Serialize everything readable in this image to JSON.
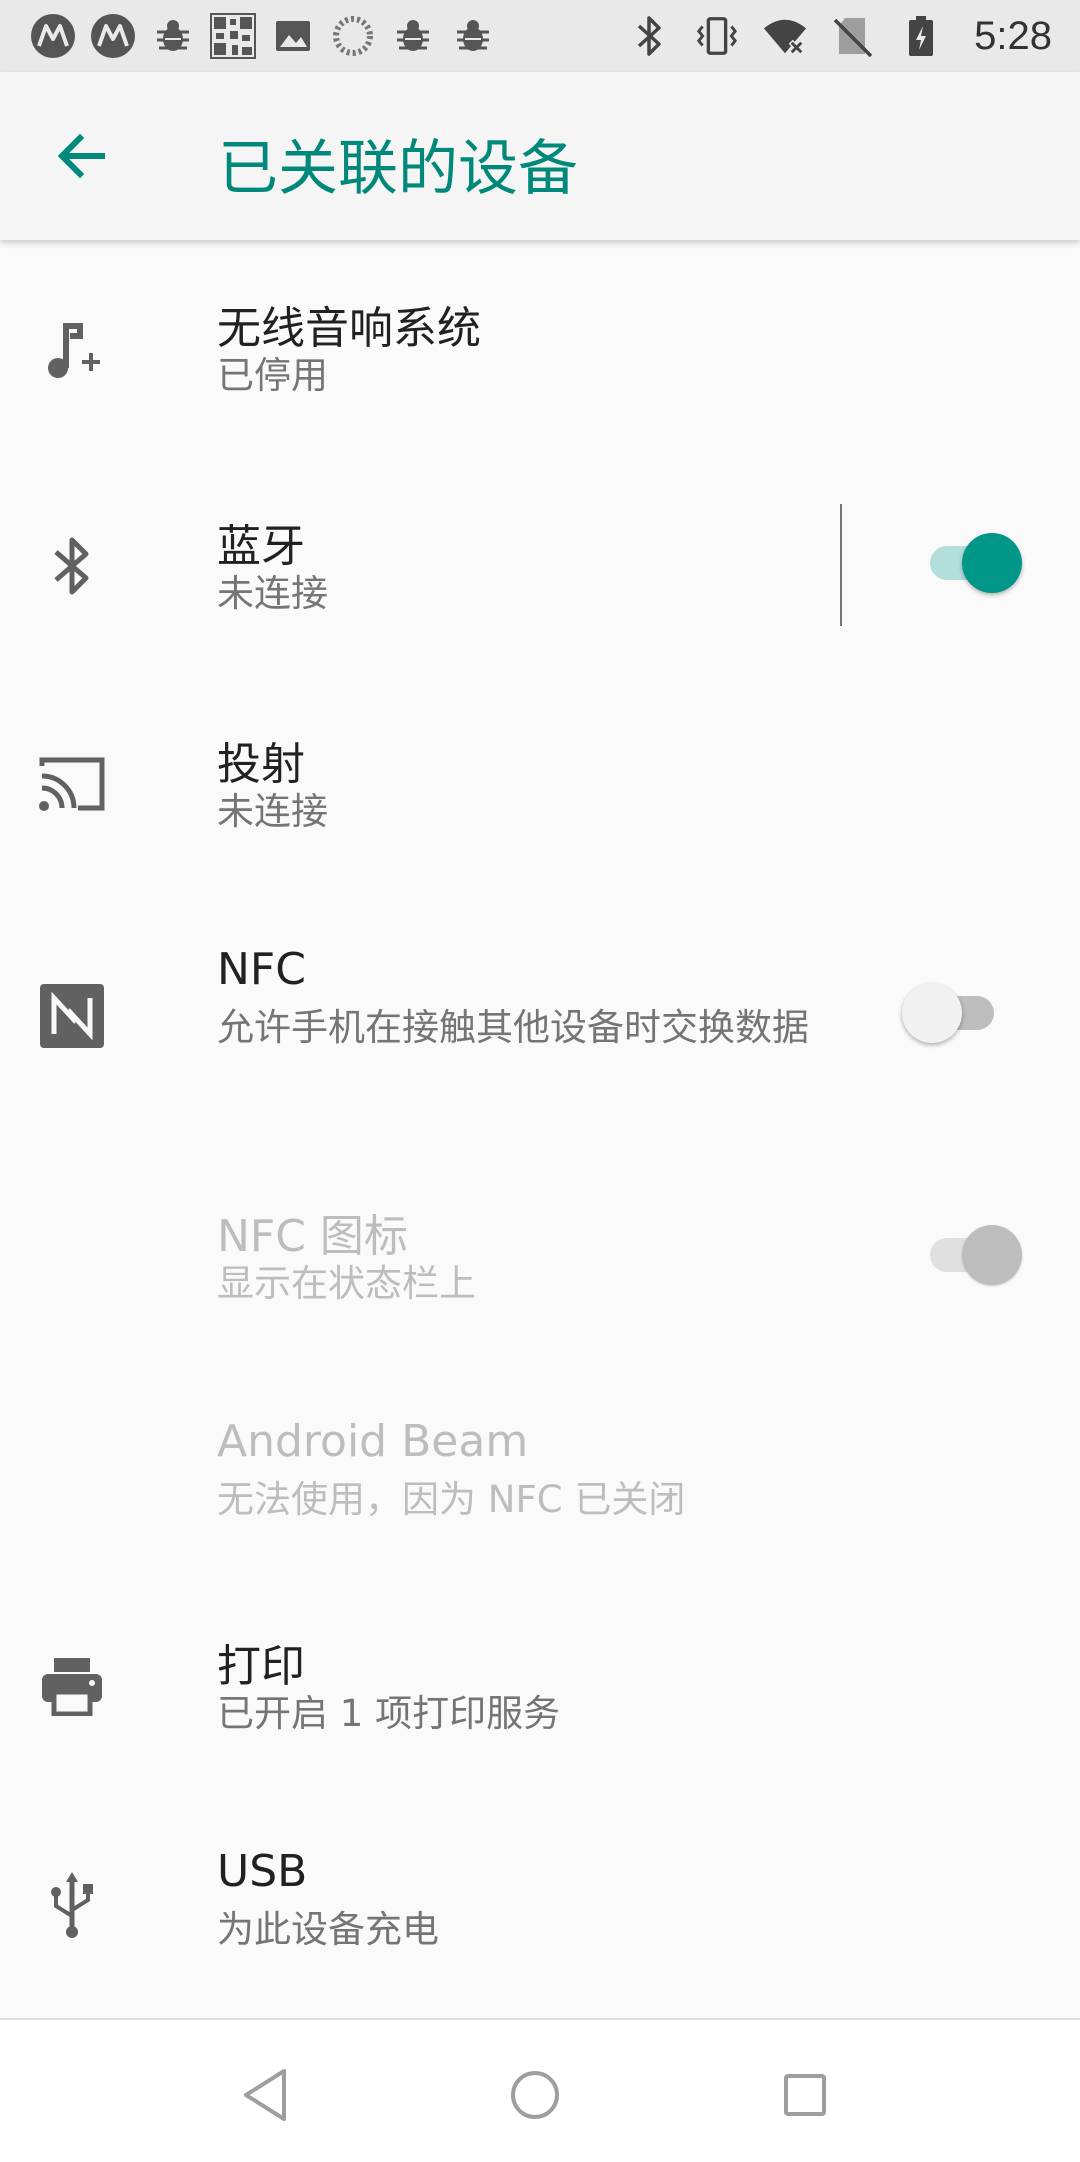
{
  "status_bar": {
    "time": "5:28",
    "left_icons": [
      "motorola-icon",
      "motorola-icon",
      "bug-icon",
      "qr-code-icon",
      "image-icon",
      "loading-icon",
      "bug-icon",
      "bug-icon"
    ],
    "right_icons": [
      "bluetooth-icon",
      "vibrate-icon",
      "wifi-icon",
      "no-sim-icon",
      "battery-icon"
    ]
  },
  "app_bar": {
    "title": "已关联的设备",
    "accent": "#00897b"
  },
  "items": [
    {
      "title": "无线音响系统",
      "subtitle": "已停用",
      "icon": "music-add-icon",
      "enabled": true
    },
    {
      "title": "蓝牙",
      "subtitle": "未连接",
      "icon": "bluetooth-icon",
      "enabled": true,
      "toggle": true
    },
    {
      "title": "投射",
      "subtitle": "未连接",
      "icon": "cast-icon",
      "enabled": true
    },
    {
      "title": "NFC",
      "subtitle": "允许手机在接触其他设备时交换数据",
      "icon": "nfc-icon",
      "enabled": true,
      "toggle": false
    },
    {
      "title": "NFC 图标",
      "subtitle": "显示在状态栏上",
      "enabled": false,
      "toggle": true
    },
    {
      "title": "Android Beam",
      "subtitle": "无法使用，因为 NFC 已关闭",
      "enabled": false
    },
    {
      "title": "打印",
      "subtitle": "已开启 1 项打印服务",
      "icon": "print-icon",
      "enabled": true
    },
    {
      "title": "USB",
      "subtitle": "为此设备充电",
      "icon": "usb-icon",
      "enabled": true
    }
  ],
  "nav_bar": {
    "buttons": [
      "back-icon",
      "home-icon",
      "recents-icon"
    ]
  }
}
